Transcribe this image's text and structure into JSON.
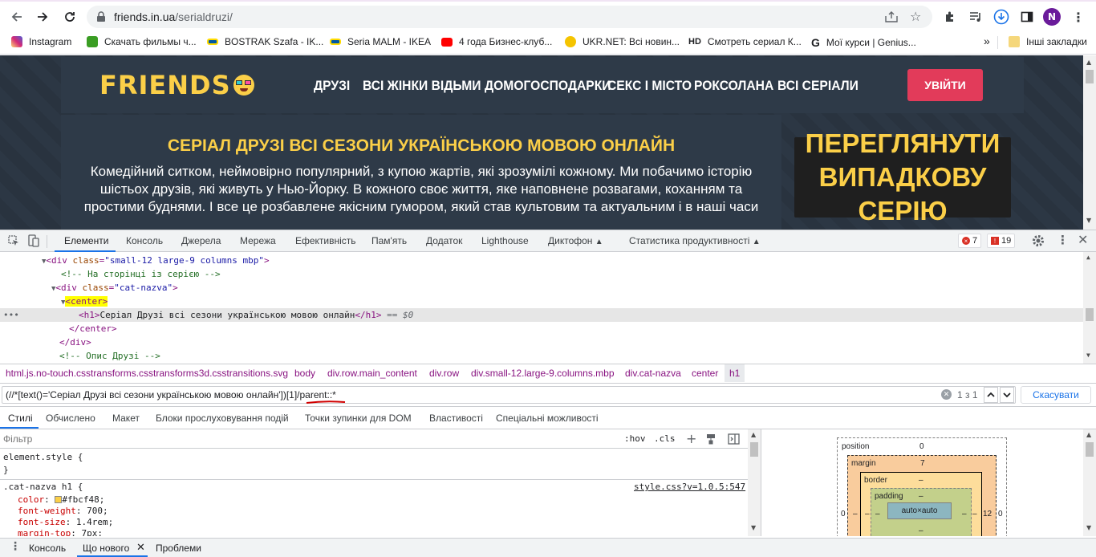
{
  "browser": {
    "url_host": "friends.in.ua",
    "url_path": "/serialdruzi/",
    "profile_initial": "N",
    "bookmarks": [
      {
        "label": "Instagram",
        "color": "#d6249f"
      },
      {
        "label": "Скачать фильмы ч...",
        "color": "#3a9d23"
      },
      {
        "label": "BOSTRAK Szafa - IK...",
        "color": "#0058a3"
      },
      {
        "label": "Seria MALM - IKEA",
        "color": "#0058a3"
      },
      {
        "label": "4 года Бизнес-клуб...",
        "color": "#ff0000"
      },
      {
        "label": "UKR.NET: Всі новин...",
        "color": "#f5c400"
      },
      {
        "label": "Смотреть сериал К...",
        "color": "#202124"
      },
      {
        "label": "Мої курси | Genius...",
        "color": "#202124"
      }
    ],
    "hd_mark": "HD",
    "bookmarks_more": "»",
    "other_bookmarks": "Інші закладки"
  },
  "site": {
    "logo": "FRIENDS",
    "nav": [
      "ДРУЗІ",
      "ВСІ ЖІНКИ ВІДЬМИ",
      "ДОМОГОСПОДАРКИ",
      "СЕКС І МІСТО",
      "РОКСОЛАНА",
      "ВСІ СЕРІАЛИ"
    ],
    "login_label": "УВІЙТИ",
    "title": "СЕРІАЛ ДРУЗІ ВСІ СЕЗОНИ УКРАЇНСЬКОЮ МОВОЮ ОНЛАЙН",
    "description": "Комедійний ситком, неймовірно популярний, з купою жартів, які зрозумілі кожному. Ми побачимо історію шістьох друзів, які живуть у Нью-Йорку. В кожного своє життя, яке наповнене розвагами, коханням та простими буднями. І все це розбавлене якісним гумором, який став культовим та актуальним і в наші часи",
    "random_line1": "ПЕРЕГЛЯНУТИ",
    "random_line2": "ВИПАДКОВУ СЕРІЮ",
    "accent_color": "#fbcf48"
  },
  "devtools": {
    "tabs": [
      "Елементи",
      "Консоль",
      "Джерела",
      "Мережа",
      "Ефективність",
      "Пам'ять",
      "Додаток",
      "Lighthouse",
      "Диктофон",
      "Статистика продуктивності"
    ],
    "errors_count": "7",
    "issues_count": "19",
    "dom": {
      "line1_tag": "div",
      "line1_attr": "class",
      "line1_val": "\"small-12 large-9 columns mbp\"",
      "line2_comment": "<!-- На сторінці із серією -->",
      "line3_tag": "div",
      "line3_attr": "class",
      "line3_val": "\"cat-nazva\"",
      "line4_tag": "<center>",
      "line5_text": "Серіал Друзі всі сезони українською мовою онлайн",
      "line5_suffix": "== $0",
      "line6_tag": "</center>",
      "line7_tag": "</div>",
      "line8_comment": "<!-- Опис Друзі -->"
    },
    "breadcrumbs": [
      "html.js.no-touch.csstransforms.csstransforms3d.csstransitions.svg",
      "body",
      "div.row.main_content",
      "div.row",
      "div.small-12.large-9.columns.mbp",
      "div.cat-nazva",
      "center",
      "h1"
    ],
    "search": {
      "query": "(//*[text()='Серіал Друзі всі сезони українською мовою онлайн'])[1]/parent::*",
      "count": "1 з 1",
      "cancel": "Скасувати"
    },
    "sub_tabs": [
      "Стилі",
      "Обчислено",
      "Макет",
      "Блоки прослуховування подій",
      "Точки зупинки для DOM",
      "Властивості",
      "Спеціальні можливості"
    ],
    "filter_placeholder": "Фільтр",
    "hov": ":hov",
    "cls": ".cls",
    "styles": {
      "element_style": "element.style {",
      "close": "}",
      "selector": ".cat-nazva h1 {",
      "source": "style.css?v=1.0.5:547",
      "props": [
        {
          "name": "color",
          "value": "#fbcf48;"
        },
        {
          "name": "font-weight",
          "value": "700;"
        },
        {
          "name": "font-size",
          "value": "1.4rem;"
        },
        {
          "name": "margin-top",
          "value": "7px;"
        }
      ],
      "swatch_color": "#fbcf48"
    },
    "box_model": {
      "position_label": "position",
      "position_val": "0",
      "margin_label": "margin",
      "margin_top": "7",
      "border_label": "border",
      "border_val": "–",
      "padding_label": "padding",
      "padding_val": "–",
      "content": "auto×auto",
      "side_left": "0",
      "side_right": "0",
      "margin_left": "–",
      "margin_right": "12",
      "dash": "–"
    },
    "drawer": [
      "Консоль",
      "Що нового",
      "Проблеми"
    ]
  }
}
